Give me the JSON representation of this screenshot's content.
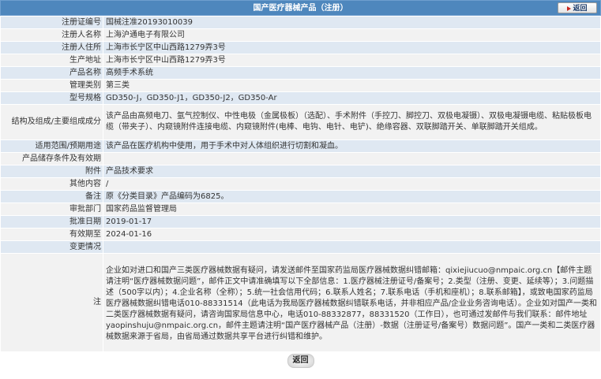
{
  "header": {
    "title": "国产医疗器械产品（注册）",
    "back_label": "返回"
  },
  "rows": [
    {
      "label": "注册证编号",
      "value": "国械注准20193010039"
    },
    {
      "label": "注册人名称",
      "value": "上海沪通电子有限公司"
    },
    {
      "label": "注册人住所",
      "value": "上海市长宁区中山西路1279弄3号"
    },
    {
      "label": "生产地址",
      "value": "上海市长宁区中山西路1279弄3号"
    },
    {
      "label": "产品名称",
      "value": "高频手术系统"
    },
    {
      "label": "管理类别",
      "value": "第三类"
    },
    {
      "label": "型号规格",
      "value": "GD350-J，GD350-J1，GD350-J2，GD350-Ar"
    },
    {
      "label": "结构及组成/主要组成成分",
      "value": "该产品由高频电刀、氩气控制仪、中性电极（金属极板）（选配）、手术附件（手控刀、脚控刀、双极电凝镊）、双极电凝镊电缆、粘贴极板电缆（带夹子）、内窥镜附件连接电缆、内窥镜附件(电棒、电钩、电针、电铲)、绝缘容器、双联脚踏开关、单联脚踏开关组成。"
    },
    {
      "label": "适用范围/预期用途",
      "value": "该产品在医疗机构中使用，用于手术中对人体组织进行切割和凝血。"
    },
    {
      "label": "产品储存条件及有效期",
      "value": ""
    },
    {
      "label": "附件",
      "value": "产品技术要求"
    },
    {
      "label": "其他内容",
      "value": "/"
    },
    {
      "label": "备注",
      "value": "原《分类目录》产品编码为6825。"
    },
    {
      "label": "审批部门",
      "value": "国家药品监督管理局"
    },
    {
      "label": "批准日期",
      "value": "2019-01-17"
    },
    {
      "label": "有效期至",
      "value": "2024-01-16"
    },
    {
      "label": "变更情况",
      "value": ""
    }
  ],
  "notes": {
    "label": "注",
    "text": "企业如对进口和国产三类医疗器械数据有疑问，请发送邮件至国家药监局医疗器械数据纠错邮箱：qixiejiucuo@nmpaic.org.cn【邮件主题请注明“医疗器械数据问题”，邮件正文中请准确填写以下全部信息：1.医疗器械注册证号/备案号；2.类型（注册、变更、延续等）；3.问题描述（500字以内）；4.企业名称（全称）；5.统一社会信用代码；6.联系人姓名；7.联系电话（手机和座机）；8.联系邮箱】，或致电国家药监局医疗器械数据纠错电话010-88331514（此电话为我局医疗器械数据纠错联系电话，并非相应产品/企业业务咨询电话）。企业如对国产一类和二类医疗器械数据有疑问，请咨询国家局信息中心，电话010-88332877，88331520（工作日），也可通过发邮件与我们联系：邮件地址yaopinshuju@nmpaic.org.cn，邮件主题请注明“国产医疗器械产品（注册）-数据（注册证号/备案号）数据问题”。国产一类和二类医疗器械数据来源于省局，由省局通过数据共享平台进行纠错和维护。"
  },
  "footer": {
    "back_label": "返回"
  }
}
